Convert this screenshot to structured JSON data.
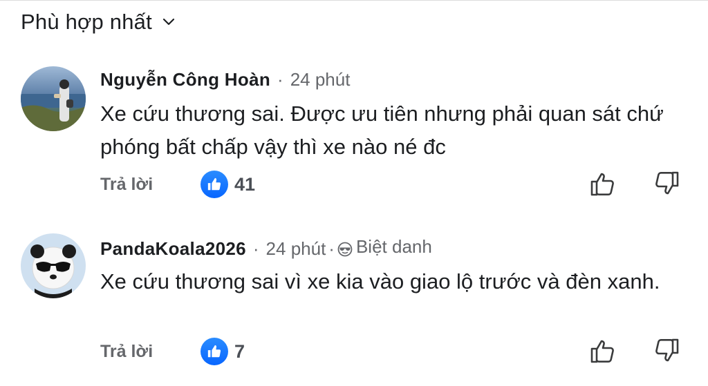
{
  "sort": {
    "label": "Phù hợp nhất",
    "icon": "chevron-down-icon"
  },
  "comments": [
    {
      "author": "Nguyễn Công Hoàn",
      "time": "24 phút",
      "badge": "",
      "text": "Xe cứu thương sai. Được ưu tiên nhưng phải quan sát chứ phóng bất chấp vậy thì xe nào né đc",
      "reply_label": "Trả lời",
      "like_count": "41"
    },
    {
      "author": "PandaKoala2026",
      "time": "24 phút",
      "badge": "Biệt danh",
      "text": "Xe cứu thương sai vì xe kia vào giao lộ trước và đèn xanh.",
      "reply_label": "Trả lời",
      "like_count": "7"
    }
  ],
  "colors": {
    "accent": "#0866ff",
    "secondary_text": "#65676b",
    "primary_text": "#1c1e21"
  }
}
